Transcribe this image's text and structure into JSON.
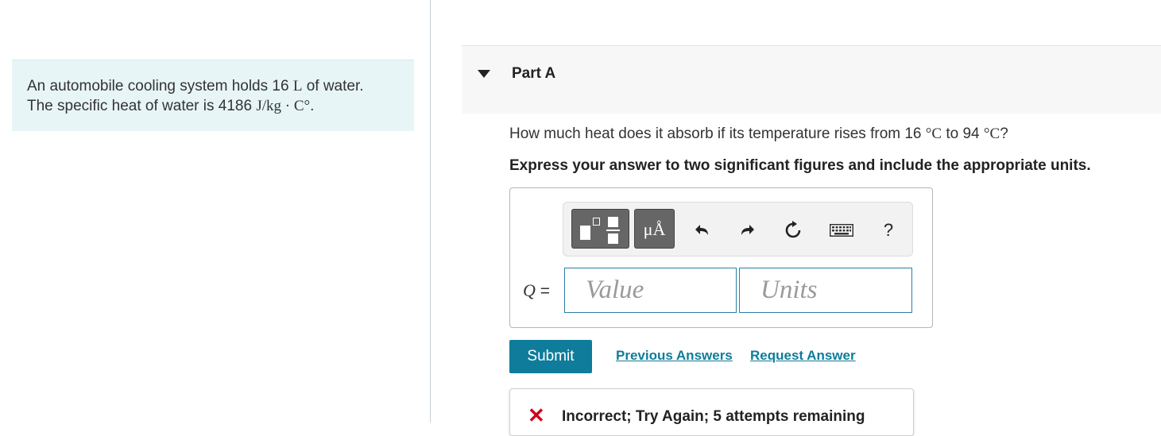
{
  "problem": {
    "line1_prefix": "An automobile cooling system holds 16",
    "line1_unit": "L",
    "line1_suffix": "of water.",
    "line2_prefix": "The specific heat of water is 4186",
    "line2_unit": "J/kg · C°",
    "line2_suffix": "."
  },
  "part": {
    "title": "Part A"
  },
  "question": {
    "prefix": "How much heat does it absorb if its temperature rises from 16",
    "unit1": "°C",
    "middle": "to 94",
    "unit2": "°C",
    "suffix": "?"
  },
  "instruction": "Express your answer to two significant figures and include the appropriate units.",
  "toolbar": {
    "units_label": "μÅ",
    "help_label": "?",
    "icons": [
      "templates-icon",
      "units-icon",
      "undo-icon",
      "redo-icon",
      "reset-icon",
      "keyboard-icon",
      "help-icon"
    ]
  },
  "answer": {
    "variable": "Q",
    "equals": "=",
    "value_placeholder": "Value",
    "units_placeholder": "Units"
  },
  "actions": {
    "submit_label": "Submit",
    "previous_answers_label": "Previous Answers",
    "request_answer_label": "Request Answer"
  },
  "feedback": {
    "text": "Incorrect; Try Again; 5 attempts remaining"
  },
  "colors": {
    "accent": "#0e7c9a",
    "problem_bg": "#e7f5f6",
    "error": "#d0021b"
  }
}
